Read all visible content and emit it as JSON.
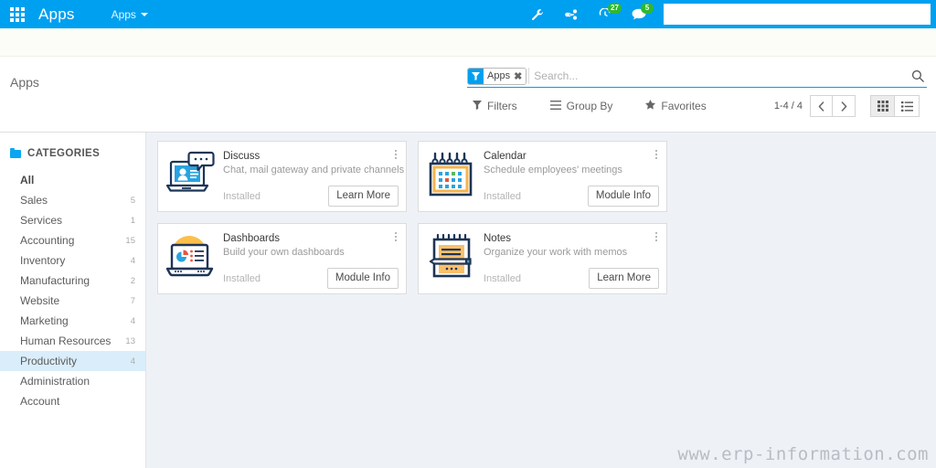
{
  "navbar": {
    "apps_grid_icon": "grid-menu-icon",
    "brand": "Apps",
    "menu_label": "Apps",
    "icons": [
      {
        "name": "wrench-icon",
        "badge": null
      },
      {
        "name": "debug-share-icon",
        "badge": null
      },
      {
        "name": "activity-clock-icon",
        "badge": "27"
      },
      {
        "name": "messages-chat-icon",
        "badge": "5"
      }
    ],
    "search_value": "",
    "search_placeholder": ""
  },
  "control_panel": {
    "breadcrumb": "Apps",
    "facet_label": "Apps",
    "facet_remove_icon": "close-x-icon",
    "search_placeholder": "Search...",
    "search_value": "",
    "search_icon": "search-icon",
    "filters_label": "Filters",
    "filters_icon": "filter-icon",
    "groupby_label": "Group By",
    "groupby_icon": "list-lines-icon",
    "favorites_label": "Favorites",
    "favorites_icon": "star-icon",
    "pager": "1-4 / 4",
    "prev_icon": "chevron-left-icon",
    "next_icon": "chevron-right-icon",
    "views": [
      {
        "name": "kanban-grid-view",
        "active": true
      },
      {
        "name": "list-view",
        "active": false
      }
    ]
  },
  "sidebar": {
    "header": "CATEGORIES",
    "header_icon": "folder-icon",
    "items": [
      {
        "label": "All",
        "count": "",
        "active": false,
        "bold": true
      },
      {
        "label": "Sales",
        "count": "5",
        "active": false
      },
      {
        "label": "Services",
        "count": "1",
        "active": false
      },
      {
        "label": "Accounting",
        "count": "15",
        "active": false
      },
      {
        "label": "Inventory",
        "count": "4",
        "active": false
      },
      {
        "label": "Manufacturing",
        "count": "2",
        "active": false
      },
      {
        "label": "Website",
        "count": "7",
        "active": false
      },
      {
        "label": "Marketing",
        "count": "4",
        "active": false
      },
      {
        "label": "Human Resources",
        "count": "13",
        "active": false
      },
      {
        "label": "Productivity",
        "count": "4",
        "active": true
      },
      {
        "label": "Administration",
        "count": "",
        "active": false
      },
      {
        "label": "Account",
        "count": "",
        "active": false
      }
    ]
  },
  "apps": [
    {
      "icon": "discuss-app-icon",
      "title": "Discuss",
      "description": "Chat, mail gateway and private channels",
      "status": "Installed",
      "button": "Learn More"
    },
    {
      "icon": "calendar-app-icon",
      "title": "Calendar",
      "description": "Schedule employees' meetings",
      "status": "Installed",
      "button": "Module Info"
    },
    {
      "icon": "dashboards-app-icon",
      "title": "Dashboards",
      "description": "Build your own dashboards",
      "status": "Installed",
      "button": "Module Info"
    },
    {
      "icon": "notes-app-icon",
      "title": "Notes",
      "description": "Organize your work with memos",
      "status": "Installed",
      "button": "Learn More"
    }
  ],
  "watermark": "www.erp-information.com",
  "colors": {
    "brand_blue": "#00a0f0",
    "badge_green": "#2eb82e",
    "content_bg": "#eef2f7",
    "active_sidebar": "#daedfa"
  }
}
